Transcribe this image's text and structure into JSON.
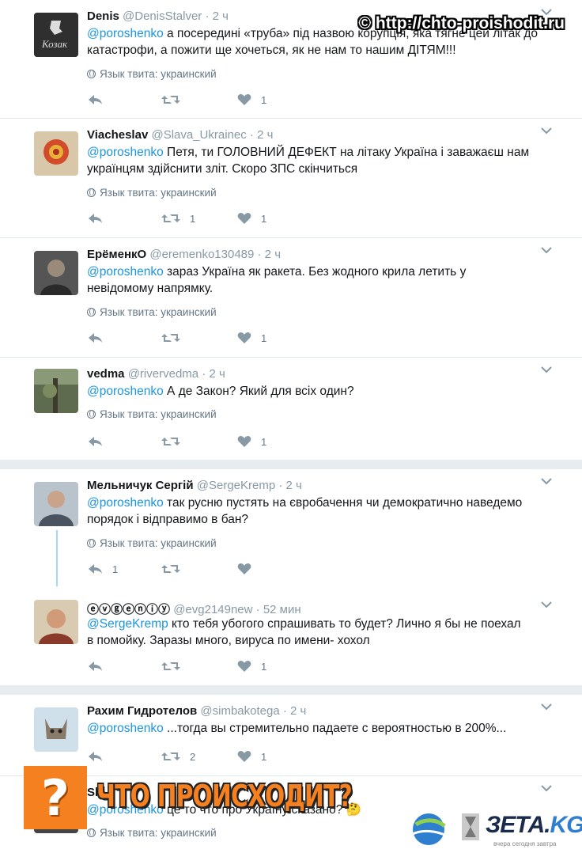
{
  "watermark": {
    "url": "© http://chto-proishodit.ru",
    "banner": "ЧТО ПРОИСХОДИТ?",
    "question": "?",
    "brand": "ЗЕТА.",
    "brand_tld": "KG",
    "brand_sub": "вчера сегодня завтра"
  },
  "lang_label": "Язык твита: украинский",
  "tweets": [
    {
      "name": "Denis",
      "handle": "@DenisStalver",
      "time": "· 2 ч",
      "mention": "@poroshenko",
      "text": " а посередині «труба» під назвою корупція, яка тягне цей літак до катастрофи, а пожити ще хочеться, як не нам то нашим ДІТЯМ!!!",
      "retweets": "",
      "likes": "1",
      "replies": ""
    },
    {
      "name": "Viacheslav",
      "handle": "@Slava_Ukrainec",
      "time": "· 2 ч",
      "mention": "@poroshenko",
      "text": " Петя, ти ГОЛОВНИЙ ДЕФЕКТ на літаку Україна і заважаєш нам українцям здійснити зліт. Скоро ЗПС скінчиться",
      "retweets": "1",
      "likes": "1",
      "replies": ""
    },
    {
      "name": "ЕрёменкО",
      "handle": "@eremenko130489",
      "time": "· 2 ч",
      "mention": "@poroshenko",
      "text": " зараз Україна як ракета. Без жодного крила летить у невідомому напрямку.",
      "retweets": "",
      "likes": "1",
      "replies": ""
    },
    {
      "name": "vedma",
      "handle": "@rivervedma",
      "time": "· 2 ч",
      "mention": "@poroshenko",
      "text": " А де Закон? Який для всіх один?",
      "retweets": "",
      "likes": "1",
      "replies": ""
    },
    {
      "name": "Мельничук Сергій",
      "handle": "@SergeKremp",
      "time": "· 2 ч",
      "mention": "@poroshenko",
      "text": " так русню пустять на євробачення чи демократично наведемо порядок і відправимо в бан?",
      "retweets": "",
      "likes": "",
      "replies": "1"
    },
    {
      "name": "ⓔⓥⓖⓔⓝⓘⓨ",
      "handle": "@evg2149new",
      "time": "· 52 мин",
      "mention": "@SergeKremp",
      "text": " кто тебя убогого спрашивать то будет? Лично я бы не поехал в помойку. Заразы много,  вируса по имени- хохол",
      "retweets": "",
      "likes": "1",
      "replies": ""
    },
    {
      "name": "Рахим Гидротелов",
      "handle": "@simbakotega",
      "time": "· 2 ч",
      "mention": "@poroshenko",
      "text": " ...тогда вы стремительно падаете с вероятностью в 200%...",
      "retweets": "2",
      "likes": "1",
      "replies": ""
    },
    {
      "name": "Sl",
      "handle": "",
      "time": "",
      "mention": "@poroshenko",
      "text": " це то что про Україну сказано? 🤔",
      "retweets": "",
      "likes": "",
      "replies": ""
    }
  ]
}
